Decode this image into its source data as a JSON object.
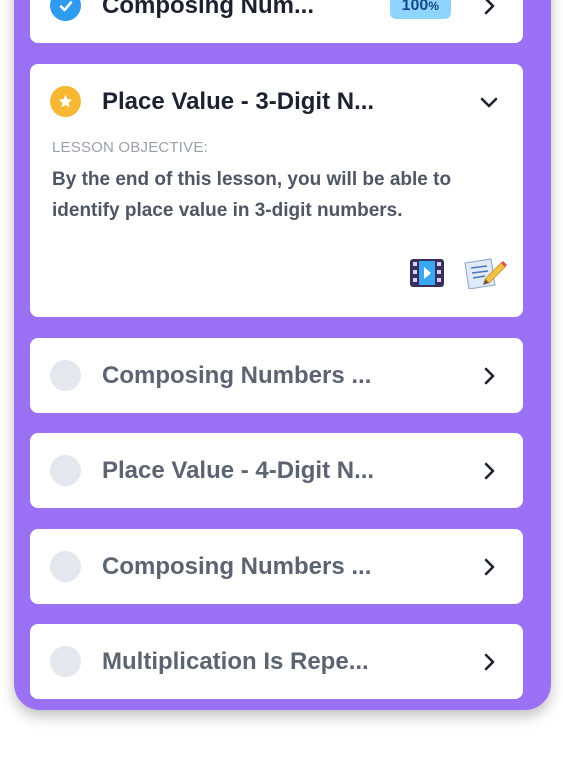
{
  "lessons": [
    {
      "status": "completed",
      "title": "Composing Num...",
      "badge": {
        "value": "100",
        "unit": "%"
      },
      "icon": "check-icon",
      "chevron": "chevron-right-icon"
    },
    {
      "status": "current",
      "title": "Place Value - 3-Digit N...",
      "icon": "star-icon",
      "chevron": "chevron-down-icon",
      "objective_label": "LESSON OBJECTIVE:",
      "objective_text": "By the end of this lesson, you will be able to identify place value in 3-digit numbers.",
      "resources": [
        "video-icon",
        "worksheet-icon"
      ]
    },
    {
      "status": "locked",
      "title": "Composing Numbers ...",
      "chevron": "chevron-right-icon"
    },
    {
      "status": "locked",
      "title": "Place Value - 4-Digit N...",
      "chevron": "chevron-right-icon"
    },
    {
      "status": "locked",
      "title": "Composing Numbers ...",
      "chevron": "chevron-right-icon"
    },
    {
      "status": "locked",
      "title": "Multiplication Is Repe...",
      "chevron": "chevron-right-icon"
    }
  ],
  "colors": {
    "panel": "#9a71f5",
    "completed": "#2d9cf0",
    "current": "#f7b733",
    "locked": "#e4e7ee",
    "badge": "#8fd3ff"
  }
}
